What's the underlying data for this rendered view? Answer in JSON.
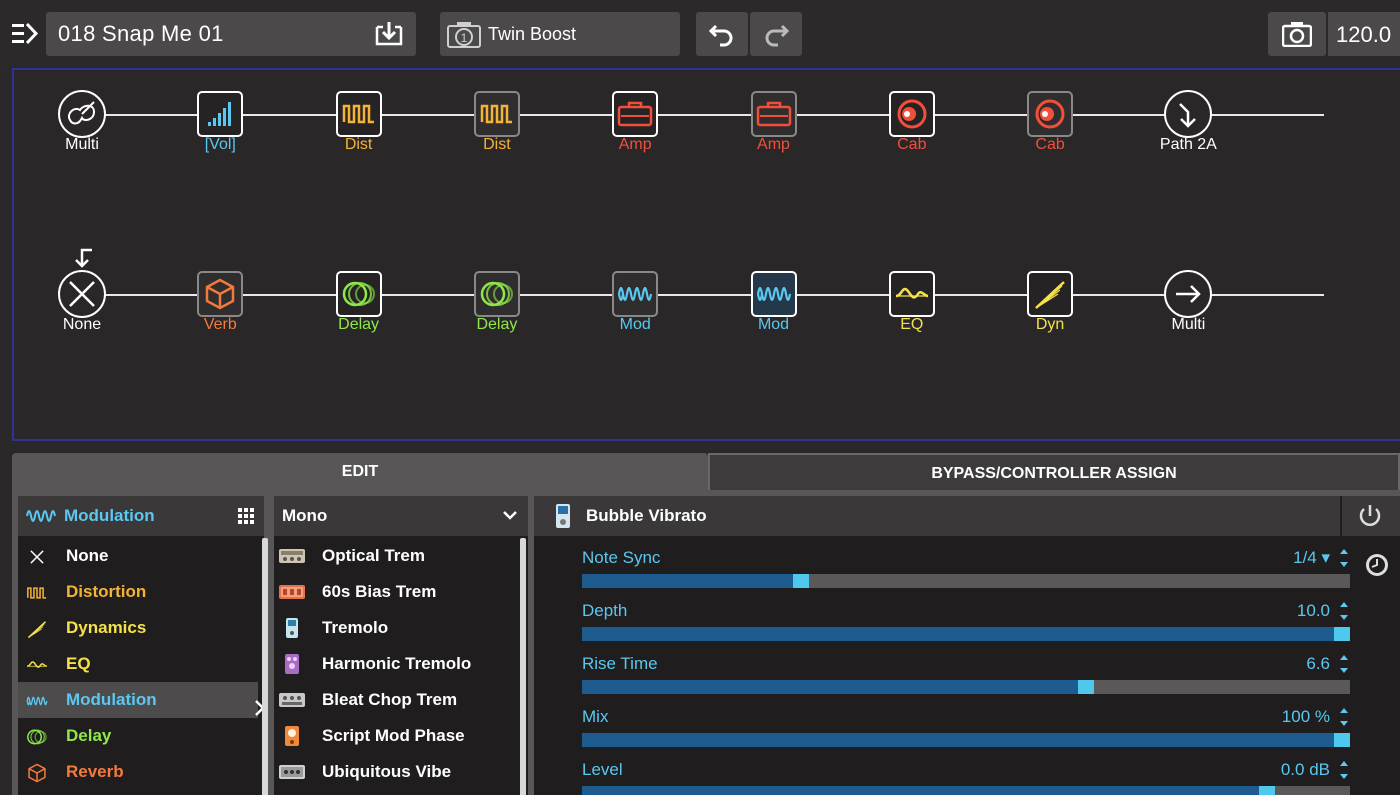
{
  "topbar": {
    "preset_name": "018  Snap Me 01",
    "snapshot_name": "Twin Boost",
    "tempo": "120.0"
  },
  "signal_flow": {
    "path_a": [
      {
        "label": "Multi",
        "kind": "input",
        "color": "#ffffff"
      },
      {
        "label": "[Vol]",
        "kind": "block",
        "color": "#5ac8f0",
        "icon": "volume-icon",
        "dim": false
      },
      {
        "label": "Dist",
        "kind": "block",
        "color": "#f5b335",
        "icon": "distortion-icon",
        "dim": false
      },
      {
        "label": "Dist",
        "kind": "block",
        "color": "#f5b335",
        "icon": "distortion-icon",
        "dim": true
      },
      {
        "label": "Amp",
        "kind": "block",
        "color": "#f24f3a",
        "icon": "amp-icon",
        "dim": false
      },
      {
        "label": "Amp",
        "kind": "block",
        "color": "#f24f3a",
        "icon": "amp-icon",
        "dim": true
      },
      {
        "label": "Cab",
        "kind": "block",
        "color": "#f24f3a",
        "icon": "cab-icon",
        "dim": false
      },
      {
        "label": "Cab",
        "kind": "block",
        "color": "#f24f3a",
        "icon": "cab-icon",
        "dim": true
      },
      {
        "label": "Path 2A",
        "kind": "output",
        "color": "#ffffff"
      }
    ],
    "path_b": [
      {
        "label": "None",
        "kind": "input",
        "color": "#ffffff"
      },
      {
        "label": "Verb",
        "kind": "block",
        "color": "#f47a3c",
        "icon": "reverb-icon",
        "dim": true
      },
      {
        "label": "Delay",
        "kind": "block",
        "color": "#8fe84a",
        "icon": "delay-icon",
        "dim": false
      },
      {
        "label": "Delay",
        "kind": "block",
        "color": "#8fe84a",
        "icon": "delay-icon",
        "dim": true
      },
      {
        "label": "Mod",
        "kind": "block",
        "color": "#5ac8f0",
        "icon": "modulation-icon",
        "dim": true
      },
      {
        "label": "Mod",
        "kind": "block",
        "color": "#5ac8f0",
        "icon": "modulation-icon",
        "dim": false,
        "selected": true
      },
      {
        "label": "EQ",
        "kind": "block",
        "color": "#f5e14a",
        "icon": "eq-icon",
        "dim": false
      },
      {
        "label": "Dyn",
        "kind": "block",
        "color": "#f5e14a",
        "icon": "dynamics-icon",
        "dim": false
      },
      {
        "label": "Multi",
        "kind": "output",
        "color": "#ffffff"
      }
    ]
  },
  "tabs": {
    "edit": "EDIT",
    "bypass": "BYPASS/CONTROLLER ASSIGN"
  },
  "categories": {
    "header": "Modulation",
    "items": [
      {
        "label": "None",
        "color": "#ffffff",
        "icon": "none-icon"
      },
      {
        "label": "Distortion",
        "color": "#f5b335",
        "icon": "distortion-icon"
      },
      {
        "label": "Dynamics",
        "color": "#f5e14a",
        "icon": "dynamics-icon"
      },
      {
        "label": "EQ",
        "color": "#f5e14a",
        "icon": "eq-icon"
      },
      {
        "label": "Modulation",
        "color": "#5ac8f0",
        "icon": "modulation-icon",
        "selected": true
      },
      {
        "label": "Delay",
        "color": "#8fe84a",
        "icon": "delay-icon"
      },
      {
        "label": "Reverb",
        "color": "#f47a3c",
        "icon": "reverb-icon"
      }
    ]
  },
  "models": {
    "header": "Mono",
    "items": [
      {
        "label": "Optical Trem"
      },
      {
        "label": "60s Bias Trem"
      },
      {
        "label": "Tremolo"
      },
      {
        "label": "Harmonic Tremolo"
      },
      {
        "label": "Bleat Chop Trem"
      },
      {
        "label": "Script Mod Phase"
      },
      {
        "label": "Ubiquitous Vibe"
      }
    ]
  },
  "params": {
    "header": "Bubble Vibrato",
    "items": [
      {
        "name": "Note Sync",
        "value": "1/4 ▾",
        "level": 0.28
      },
      {
        "name": "Depth",
        "value": "10.0",
        "level": 1.0
      },
      {
        "name": "Rise Time",
        "value": "6.6",
        "level": 0.66
      },
      {
        "name": "Mix",
        "value": "100 %",
        "level": 1.0
      },
      {
        "name": "Level",
        "value": "0.0 dB",
        "level": 0.9
      }
    ]
  }
}
